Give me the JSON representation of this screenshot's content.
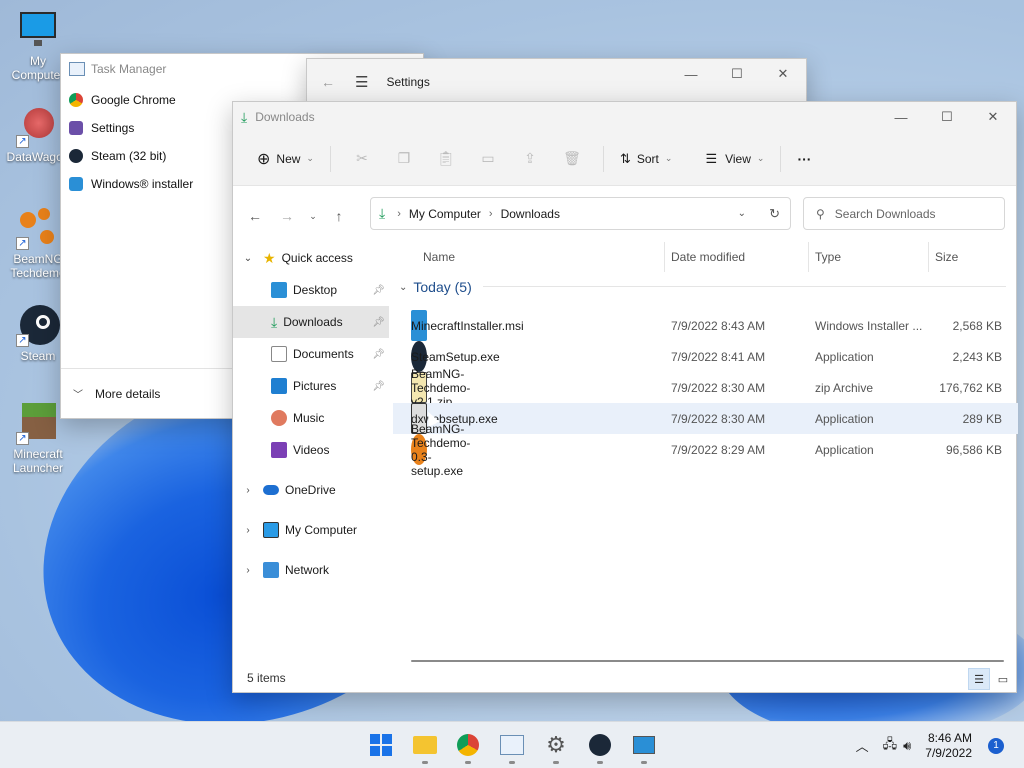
{
  "desktop": {
    "icons": [
      {
        "label": "My Computer",
        "icon": "monitor-icon"
      },
      {
        "label": "DataWagon",
        "icon": "datawagon-icon"
      },
      {
        "label": "BeamNG Techdemo",
        "icon": "beamng-icon"
      },
      {
        "label": "Steam",
        "icon": "steam-icon"
      },
      {
        "label": "Minecraft Launcher",
        "icon": "minecraft-icon"
      }
    ]
  },
  "task_manager": {
    "title": "Task Manager",
    "apps": [
      "Google Chrome",
      "Settings",
      "Steam (32 bit)",
      "Windows® installer"
    ],
    "more_details": "More details"
  },
  "settings": {
    "title": "Settings"
  },
  "explorer": {
    "title": "Downloads",
    "toolbar": {
      "new_label": "New",
      "sort_label": "Sort",
      "view_label": "View",
      "more_label": "···"
    },
    "address": {
      "crumbs": [
        "My Computer",
        "Downloads"
      ]
    },
    "search_placeholder": "Search Downloads",
    "nav": {
      "quick_access": "Quick access",
      "pinned": [
        "Desktop",
        "Downloads",
        "Documents",
        "Pictures"
      ],
      "unpinned": [
        "Music",
        "Videos"
      ],
      "onedrive": "OneDrive",
      "my_computer": "My Computer",
      "network": "Network"
    },
    "columns": {
      "name": "Name",
      "date": "Date modified",
      "type": "Type",
      "size": "Size"
    },
    "group_label": "Today (5)",
    "files": [
      {
        "name": "MinecraftInstaller.msi",
        "date": "7/9/2022 8:43 AM",
        "type": "Windows Installer ...",
        "size": "2,568 KB"
      },
      {
        "name": "SteamSetup.exe",
        "date": "7/9/2022 8:41 AM",
        "type": "Application",
        "size": "2,243 KB"
      },
      {
        "name": "BeamNG-Techdemo-v2.1.zip",
        "date": "7/9/2022 8:30 AM",
        "type": "zip Archive",
        "size": "176,762 KB"
      },
      {
        "name": "dxwebsetup.exe",
        "date": "7/9/2022 8:30 AM",
        "type": "Application",
        "size": "289 KB"
      },
      {
        "name": "BeamNG-Techdemo-0.3-setup.exe",
        "date": "7/9/2022 8:29 AM",
        "type": "Application",
        "size": "96,586 KB"
      }
    ],
    "status": "5 items"
  },
  "taskbar": {
    "time": "8:46 AM",
    "date": "7/9/2022",
    "notification_count": "1"
  }
}
